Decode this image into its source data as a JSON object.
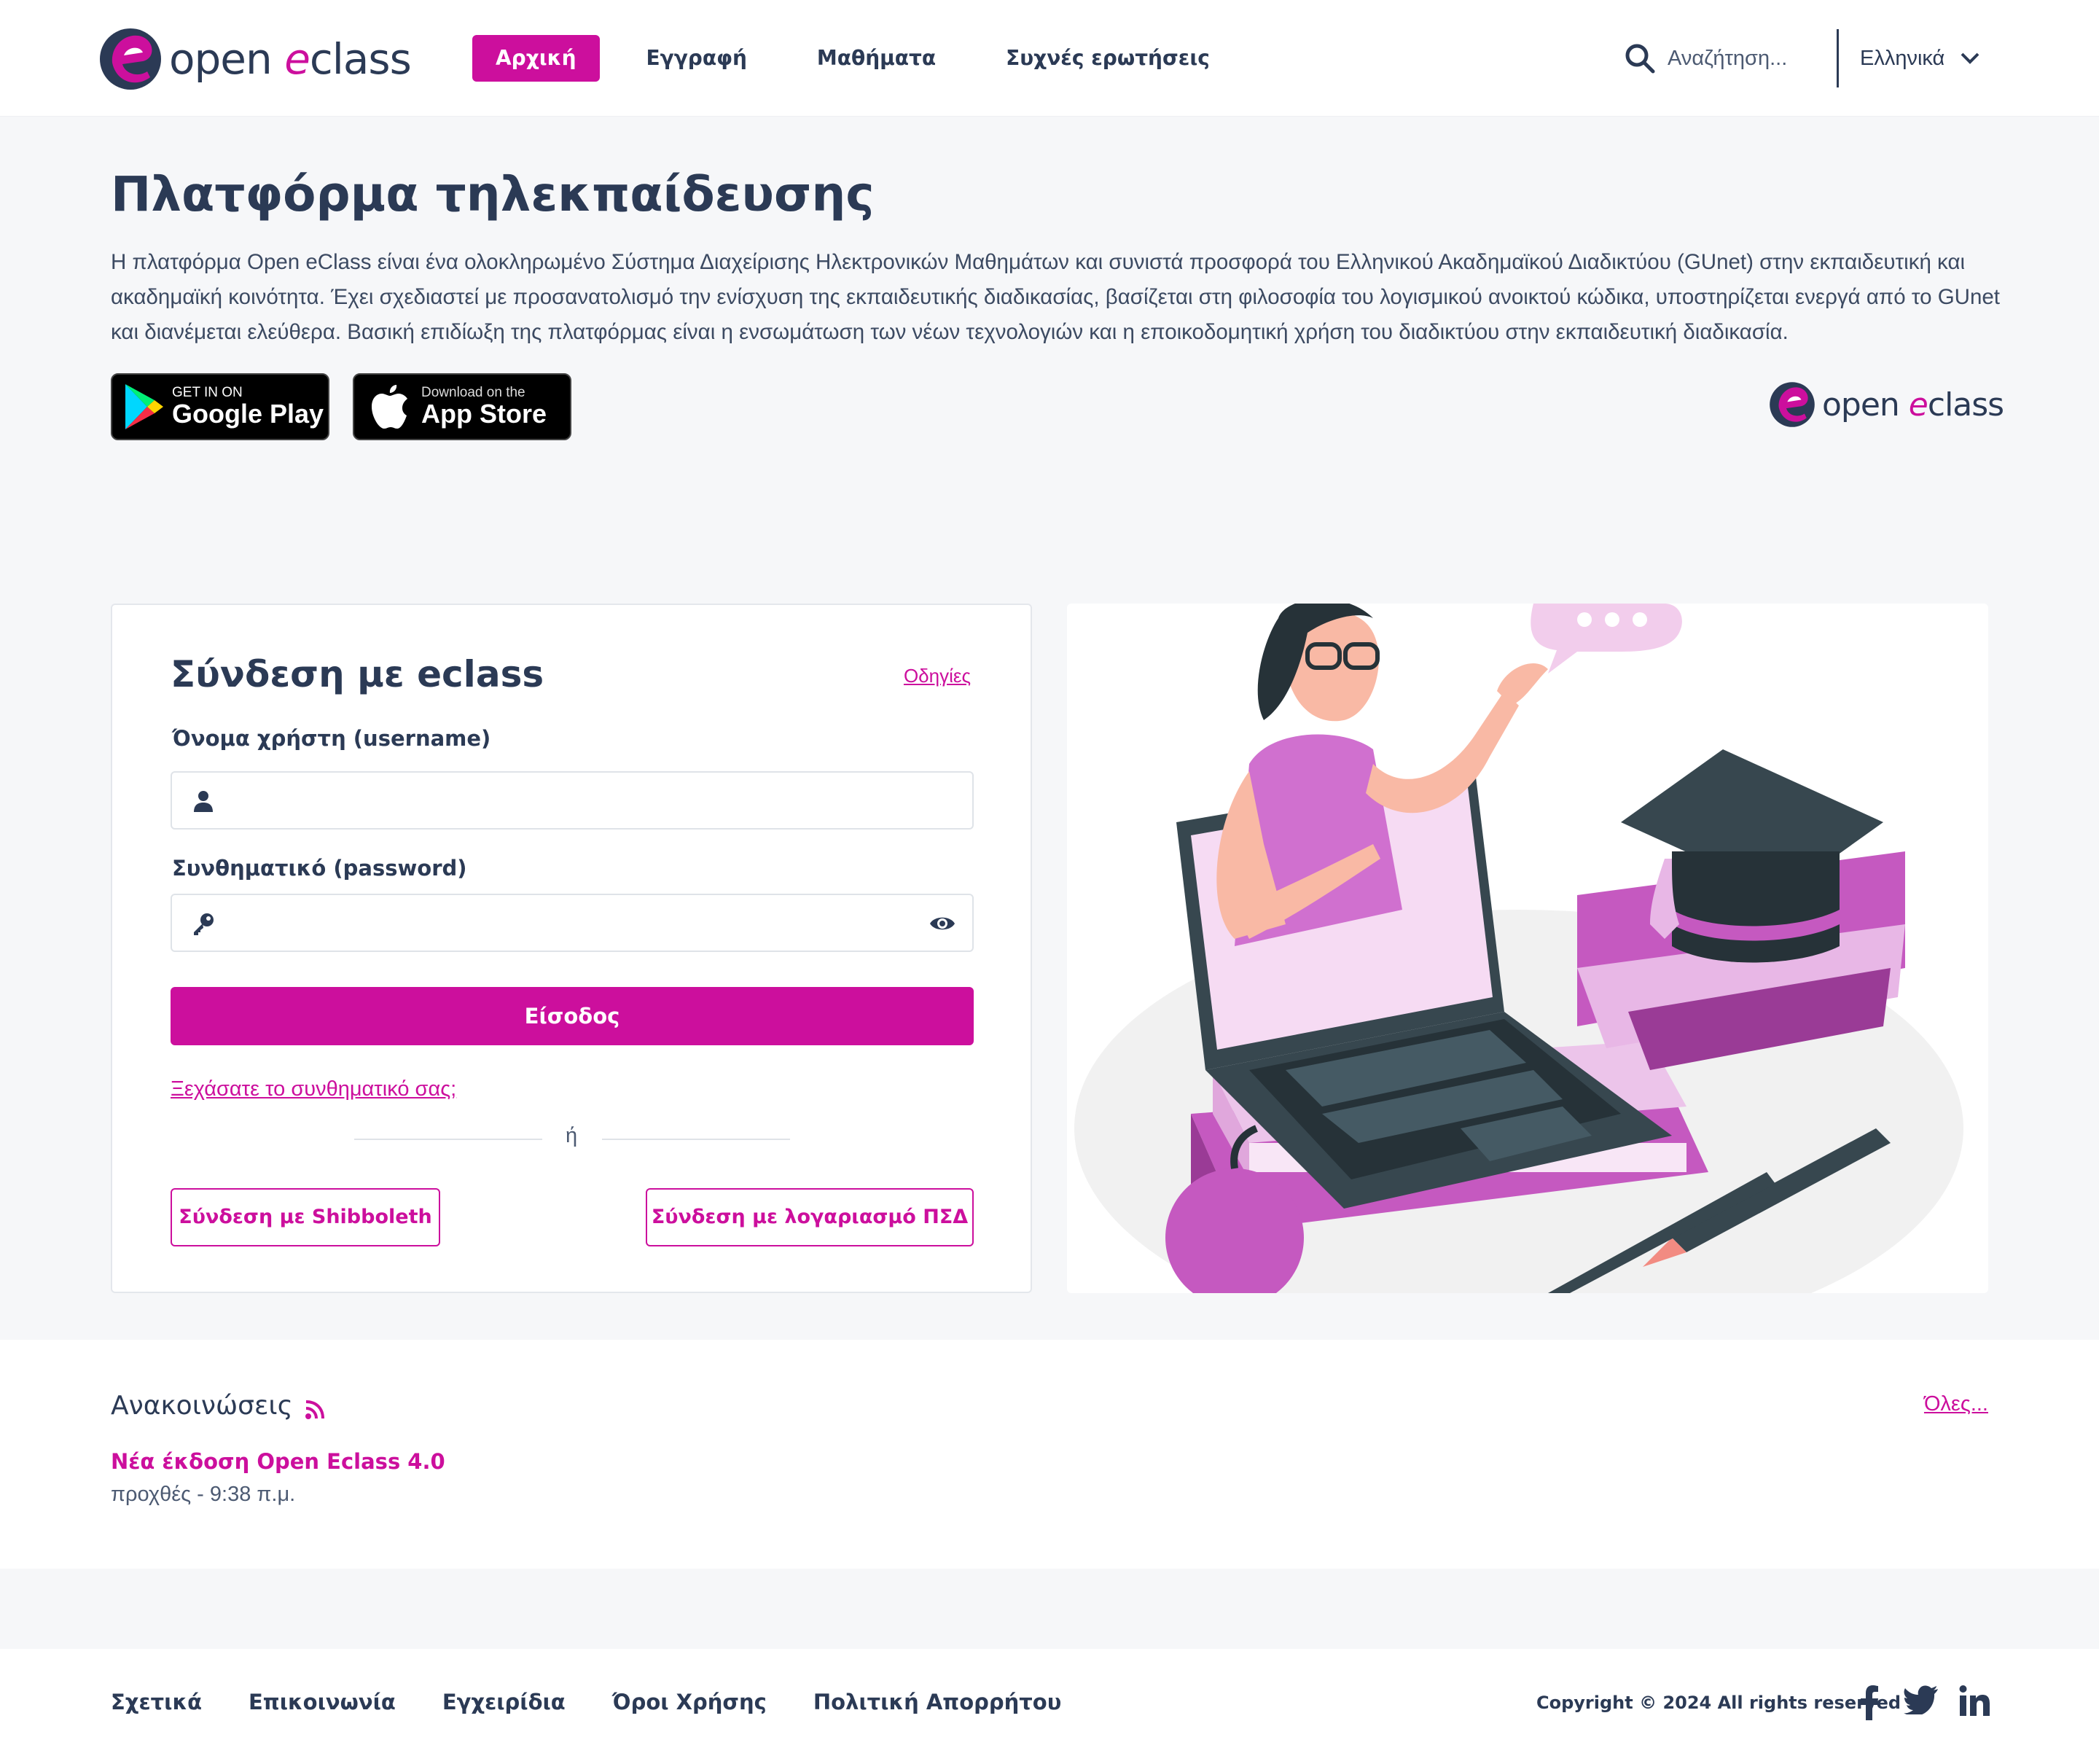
{
  "header": {
    "logo": {
      "part1": "open ",
      "part2": "e",
      "part3": "class"
    },
    "nav": [
      {
        "label": "Αρχική",
        "active": true
      },
      {
        "label": "Εγγραφή"
      },
      {
        "label": "Μαθήματα"
      },
      {
        "label": "Συχνές ερωτήσεις"
      }
    ],
    "search_placeholder": "Αναζήτηση...",
    "language": "Ελληνικά"
  },
  "hero": {
    "title": "Πλατφόρμα τηλεκπαίδευσης",
    "description": "Η πλατφόρμα Open eClass είναι ένα ολοκληρωμένο Σύστημα Διαχείρισης Ηλεκτρονικών Μαθημάτων και συνιστά προσφορά του Ελληνικού Ακαδημαϊκού Διαδικτύου (GUnet) στην εκπαιδευτική και ακαδημαϊκή κοινότητα. Έχει σχεδιαστεί με προσανατολισμό την ενίσχυση της εκπαιδευτικής διαδικασίας, βασίζεται στη φιλοσοφία του λογισμικού ανοικτού κώδικα, υποστηρίζεται ενεργά από το GUnet και διανέμεται ελεύθερα. Βασική επιδίωξη της πλατφόρμας είναι η ενσωμάτωση των νέων τεχνολογιών και η εποικοδομητική χρήση του διαδικτύου στην εκπαιδευτική διαδικασία.",
    "google_play": {
      "small": "GET IN ON",
      "big": "Google Play"
    },
    "app_store": {
      "small": "Download on the",
      "big": "App Store"
    }
  },
  "login": {
    "title": "Σύνδεση με eclass",
    "help": "Οδηγίες",
    "username_label": "Όνομα χρήστη (username)",
    "password_label": "Συνθηματικό (password)",
    "submit": "Είσοδος",
    "forgot": "Ξεχάσατε το συνθηματικό σας;",
    "or": "ή",
    "shibboleth": "Σύνδεση με Shibboleth",
    "psd": "Σύνδεση με λογαριασμό ΠΣΔ"
  },
  "announcements": {
    "title": "Ανακοινώσεις",
    "all": "Όλες...",
    "items": [
      {
        "title": "Νέα έκδοση Open Eclass 4.0",
        "date": "προχθές - 9:38 π.μ."
      }
    ]
  },
  "footer": {
    "links": [
      "Σχετικά",
      "Επικοινωνία",
      "Εγχειρίδια",
      "Όροι Χρήσης",
      "Πολιτική Απορρήτου"
    ],
    "copyright": "Copyright © 2024 All rights reserved",
    "social": [
      "facebook-icon",
      "twitter-icon",
      "linkedin-icon"
    ]
  },
  "colors": {
    "brand": "#cc0f9d",
    "text": "#2b3a55",
    "bg": "#f6f7f9"
  }
}
